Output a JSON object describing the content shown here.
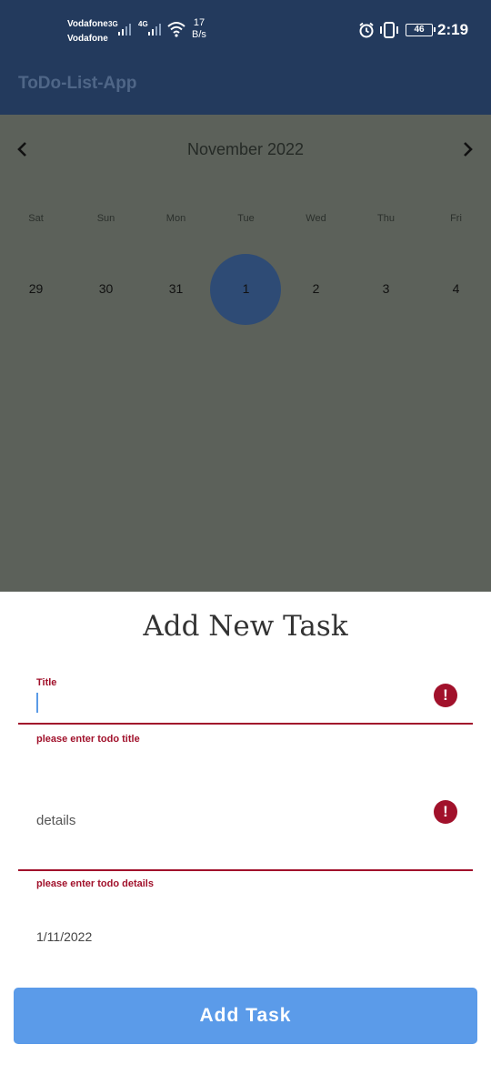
{
  "status_bar": {
    "carrier_1": "Vodafone",
    "carrier_2": "Vodafone",
    "net_1": "3G",
    "net_2": "4G",
    "speed_value": "17",
    "speed_unit": "B/s",
    "battery": "46",
    "time": "2:19",
    "icons": [
      "signal-icon",
      "wifi-icon",
      "alarm-icon",
      "vibrate-icon",
      "battery-icon"
    ]
  },
  "app_bar": {
    "title": "ToDo-List-App"
  },
  "calendar": {
    "month": "November 2022",
    "days": [
      "Sat",
      "Sun",
      "Mon",
      "Tue",
      "Wed",
      "Thu",
      "Fri"
    ],
    "dates": [
      "29",
      "30",
      "31",
      "1",
      "2",
      "3",
      "4"
    ],
    "selected_date": "1",
    "selected_color": "#2e4b75"
  },
  "sheet": {
    "title": "Add New Task",
    "title_field": {
      "label": "Title",
      "value": "",
      "error": "please enter todo title"
    },
    "details_field": {
      "placeholder": "details",
      "value": "",
      "error": "please enter todo details"
    },
    "date": "1/11/2022",
    "submit_label": "Add Task"
  },
  "colors": {
    "primary": "#233a5d",
    "error": "#a1112b",
    "button": "#5b9be9",
    "overlay": "#5c615a"
  }
}
